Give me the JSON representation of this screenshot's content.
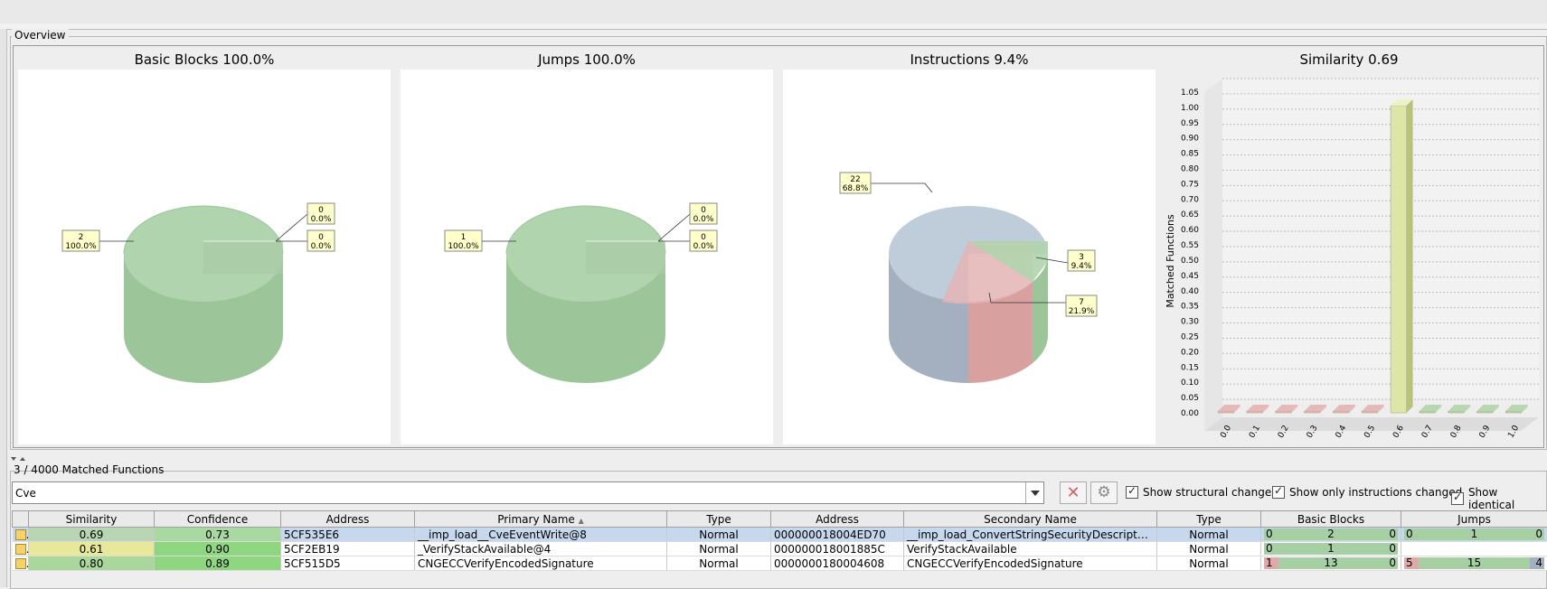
{
  "overview": {
    "title": "Overview",
    "charts": {
      "basic_blocks_title": "Basic Blocks 100.0%",
      "jumps_title": "Jumps 100.0%",
      "instructions_title": "Instructions 9.4%",
      "similarity_title": "Similarity 0.69"
    },
    "pie_labels": {
      "bb_main_count": "2",
      "bb_main_pct": "100.0%",
      "bb_a_count": "0",
      "bb_a_pct": "0.0%",
      "bb_b_count": "0",
      "bb_b_pct": "0.0%",
      "j_main_count": "1",
      "j_main_pct": "100.0%",
      "j_a_count": "0",
      "j_a_pct": "0.0%",
      "j_b_count": "0",
      "j_b_pct": "0.0%",
      "i_main_count": "22",
      "i_main_pct": "68.8%",
      "i_a_count": "3",
      "i_a_pct": "9.4%",
      "i_b_count": "7",
      "i_b_pct": "21.9%"
    }
  },
  "colors": {
    "matched_green": "#9cc59a",
    "unmatched_gray": "#a4b0c0",
    "changed_red": "#d9a0a0",
    "bar_yellow": "#dde6a6"
  },
  "chart_data": [
    {
      "type": "pie",
      "title": "Basic Blocks 100.0%",
      "values": [
        2,
        0,
        0
      ],
      "percents": [
        "100.0%",
        "0.0%",
        "0.0%"
      ]
    },
    {
      "type": "pie",
      "title": "Jumps 100.0%",
      "values": [
        1,
        0,
        0
      ],
      "percents": [
        "100.0%",
        "0.0%",
        "0.0%"
      ]
    },
    {
      "type": "pie",
      "title": "Instructions 9.4%",
      "values": [
        22,
        3,
        7
      ],
      "percents": [
        "68.8%",
        "9.4%",
        "21.9%"
      ]
    },
    {
      "type": "bar",
      "title": "Similarity 0.69",
      "ylabel": "Matched Functions",
      "categories": [
        "0.0",
        "0.1",
        "0.2",
        "0.3",
        "0.4",
        "0.5",
        "0.6",
        "0.7",
        "0.8",
        "0.9",
        "1.0"
      ],
      "values": [
        0,
        0,
        0,
        0,
        0,
        0,
        1,
        0,
        0,
        0,
        0
      ],
      "ylim": [
        0,
        1.05
      ],
      "yticks": [
        "0.00",
        "0.05",
        "0.10",
        "0.15",
        "0.20",
        "0.25",
        "0.30",
        "0.35",
        "0.40",
        "0.45",
        "0.50",
        "0.55",
        "0.60",
        "0.65",
        "0.70",
        "0.75",
        "0.80",
        "0.85",
        "0.90",
        "0.95",
        "1.00",
        "1.05"
      ],
      "grid": true
    }
  ],
  "functions_panel": {
    "title": "3 / 4000 Matched Functions",
    "search_value": "Cve",
    "checkboxes": [
      "Show structural changes",
      "Show only instructions changed",
      "Show identical"
    ]
  },
  "table": {
    "headers": [
      "Similarity",
      "Confidence",
      "Address",
      "Primary Name",
      "Type",
      "Address",
      "Secondary Name",
      "Type",
      "Basic Blocks",
      "Jumps"
    ],
    "rows": [
      {
        "similarity": "0.69",
        "confidence": "0.73",
        "p_address": "5CF535E6",
        "primary_name": "__imp_load__CveEventWrite@8",
        "p_type": "Normal",
        "s_address": "000000018004ED70",
        "secondary_name": "__imp_load_ConvertStringSecurityDescriptorT...",
        "s_type": "Normal",
        "bb": [
          "0",
          "2",
          "0"
        ],
        "j": [
          "0",
          "1",
          "0"
        ]
      },
      {
        "similarity": "0.61",
        "confidence": "0.90",
        "p_address": "5CF2EB19",
        "primary_name": "_VerifyStackAvailable@4",
        "p_type": "Normal",
        "s_address": "000000018001885C",
        "secondary_name": "VerifyStackAvailable",
        "s_type": "Normal",
        "bb": [
          "0",
          "1",
          "0"
        ],
        "j": [
          "",
          "",
          ""
        ]
      },
      {
        "similarity": "0.80",
        "confidence": "0.89",
        "p_address": "5CF515D5",
        "primary_name": "CNGECCVerifyEncodedSignature",
        "p_type": "Normal",
        "s_address": "0000000180004608",
        "secondary_name": "CNGECCVerifyEncodedSignature",
        "s_type": "Normal",
        "bb": [
          "1",
          "13",
          "0"
        ],
        "j": [
          "5",
          "15",
          "4"
        ]
      }
    ]
  }
}
